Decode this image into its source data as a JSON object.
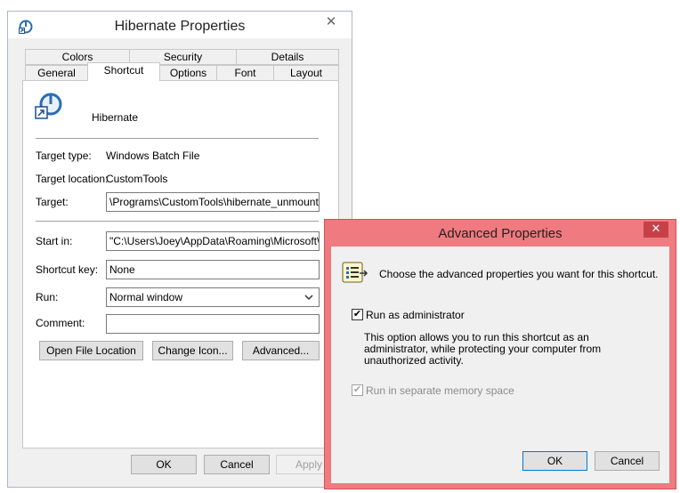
{
  "main_window": {
    "title": "Hibernate Properties",
    "close_glyph": "✕",
    "tabs_row1": [
      "Colors",
      "Security",
      "Details"
    ],
    "tabs_row2": [
      "General",
      "Shortcut",
      "Options",
      "Font",
      "Layout"
    ],
    "active_tab": "Shortcut",
    "shortcut_name": "Hibernate",
    "target_type_label": "Target type:",
    "target_type_value": "Windows Batch File",
    "target_location_label": "Target location:",
    "target_location_value": "CustomTools",
    "target_label": "Target:",
    "target_value": "\\Programs\\CustomTools\\hibernate_unmount.bat\"",
    "start_in_label": "Start in:",
    "start_in_value": "\"C:\\Users\\Joey\\AppData\\Roaming\\Microsoft\\Wi",
    "shortcut_key_label": "Shortcut key:",
    "shortcut_key_value": "None",
    "run_label": "Run:",
    "run_value": "Normal window",
    "comment_label": "Comment:",
    "comment_value": "",
    "open_file_location_label": "Open File Location",
    "change_icon_label": "Change Icon...",
    "advanced_label": "Advanced...",
    "ok_label": "OK",
    "cancel_label": "Cancel",
    "apply_label": "Apply"
  },
  "advanced_dialog": {
    "title": "Advanced Properties",
    "close_glyph": "✕",
    "prompt": "Choose the advanced properties you want for this shortcut.",
    "run_as_admin_label": "Run as administrator",
    "run_as_admin_checked": true,
    "description_lines": [
      "This option allows you to run this shortcut as an",
      "administrator, while protecting your computer from",
      "unauthorized activity."
    ],
    "separate_memory_label": "Run in separate memory space",
    "separate_memory_checked": true,
    "ok_label": "OK",
    "cancel_label": "Cancel"
  },
  "icons": {
    "app_icon": "shortcut-power-icon",
    "dialog_icon": "properties-list-icon"
  },
  "colors": {
    "dialog_frame": "#ef7a80",
    "window_bg": "#f0f0f0",
    "focus_border": "#0078d7"
  }
}
